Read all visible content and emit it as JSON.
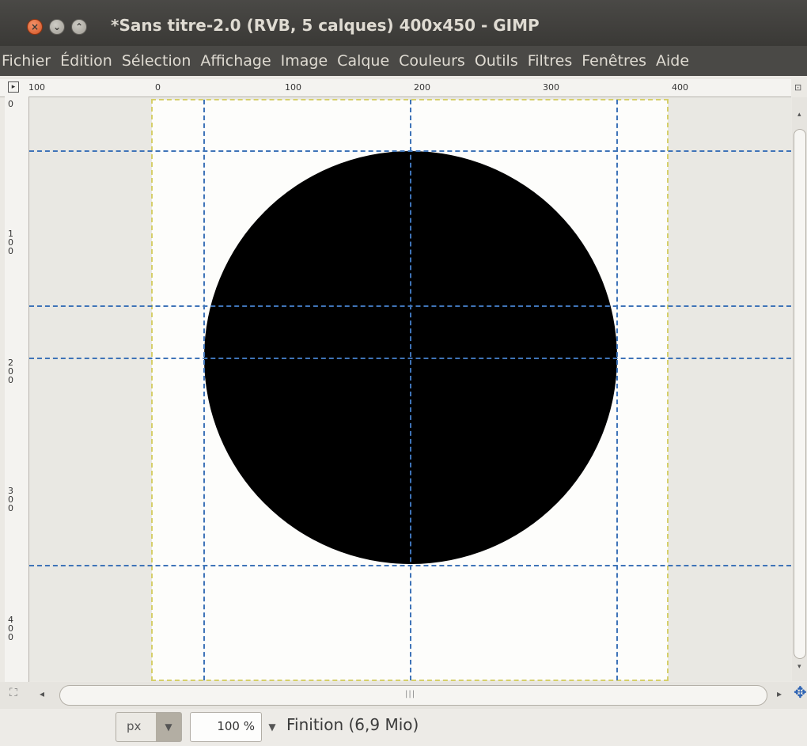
{
  "window": {
    "title": "*Sans titre-2.0 (RVB, 5 calques) 400x450 - GIMP",
    "close_glyph": "×",
    "minimize_glyph": "⌄",
    "maximize_glyph": "⌃"
  },
  "menubar": {
    "items": [
      "Fichier",
      "Édition",
      "Sélection",
      "Affichage",
      "Image",
      "Calque",
      "Couleurs",
      "Outils",
      "Filtres",
      "Fenêtres",
      "Aide"
    ]
  },
  "rulers": {
    "horizontal_labels": [
      "100",
      "0",
      "100",
      "200",
      "300",
      "400"
    ],
    "vertical_labels": [
      "0",
      "100",
      "200",
      "300",
      "400"
    ],
    "corner_glyph": "▸"
  },
  "canvas": {
    "background_color": "#ebe9e4",
    "image_color": "#fdfdfb",
    "shape_color": "#000000",
    "guide_color": "#3f74b8",
    "layer_border_color": "#d6cf6a"
  },
  "scrollbars": {
    "left_arrow": "◂",
    "right_arrow": "▸",
    "up_arrow": "▴",
    "down_arrow": "▾",
    "grip": "|||"
  },
  "statusbar": {
    "unit": "px",
    "zoom": "100 %",
    "status": "Finition (6,9 Mio)",
    "combo_arrow": "▼"
  },
  "icons": {
    "quick_mask": "quick-mask-icon",
    "navigate": "navigate-icon"
  }
}
